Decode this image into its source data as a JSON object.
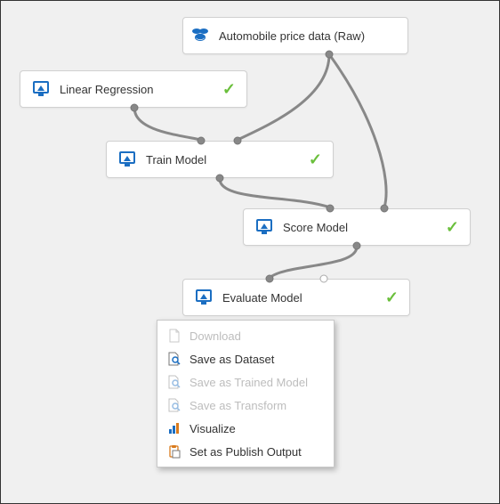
{
  "canvas": {
    "colors": {
      "node_border": "#d0d0d0",
      "accent_blue": "#1b6ec2",
      "accent_orange": "#d97b1d",
      "check_green": "#6abf3b",
      "disabled_text": "#bdbdbd"
    },
    "nodes": {
      "data": {
        "label": "Automobile price data (Raw)"
      },
      "linreg": {
        "label": "Linear Regression"
      },
      "train": {
        "label": "Train Model"
      },
      "score": {
        "label": "Score Model"
      },
      "evaluate": {
        "label": "Evaluate Model"
      }
    },
    "context_menu": {
      "items": [
        {
          "key": "download",
          "label": "Download",
          "enabled": false,
          "icon": "page"
        },
        {
          "key": "save_dataset",
          "label": "Save as Dataset",
          "enabled": true,
          "icon": "mag"
        },
        {
          "key": "save_trained",
          "label": "Save as Trained Model",
          "enabled": false,
          "icon": "mag"
        },
        {
          "key": "save_transform",
          "label": "Save as Transform",
          "enabled": false,
          "icon": "mag"
        },
        {
          "key": "visualize",
          "label": "Visualize",
          "enabled": true,
          "icon": "chart"
        },
        {
          "key": "publish",
          "label": "Set as Publish Output",
          "enabled": true,
          "icon": "clipboard"
        }
      ]
    }
  }
}
